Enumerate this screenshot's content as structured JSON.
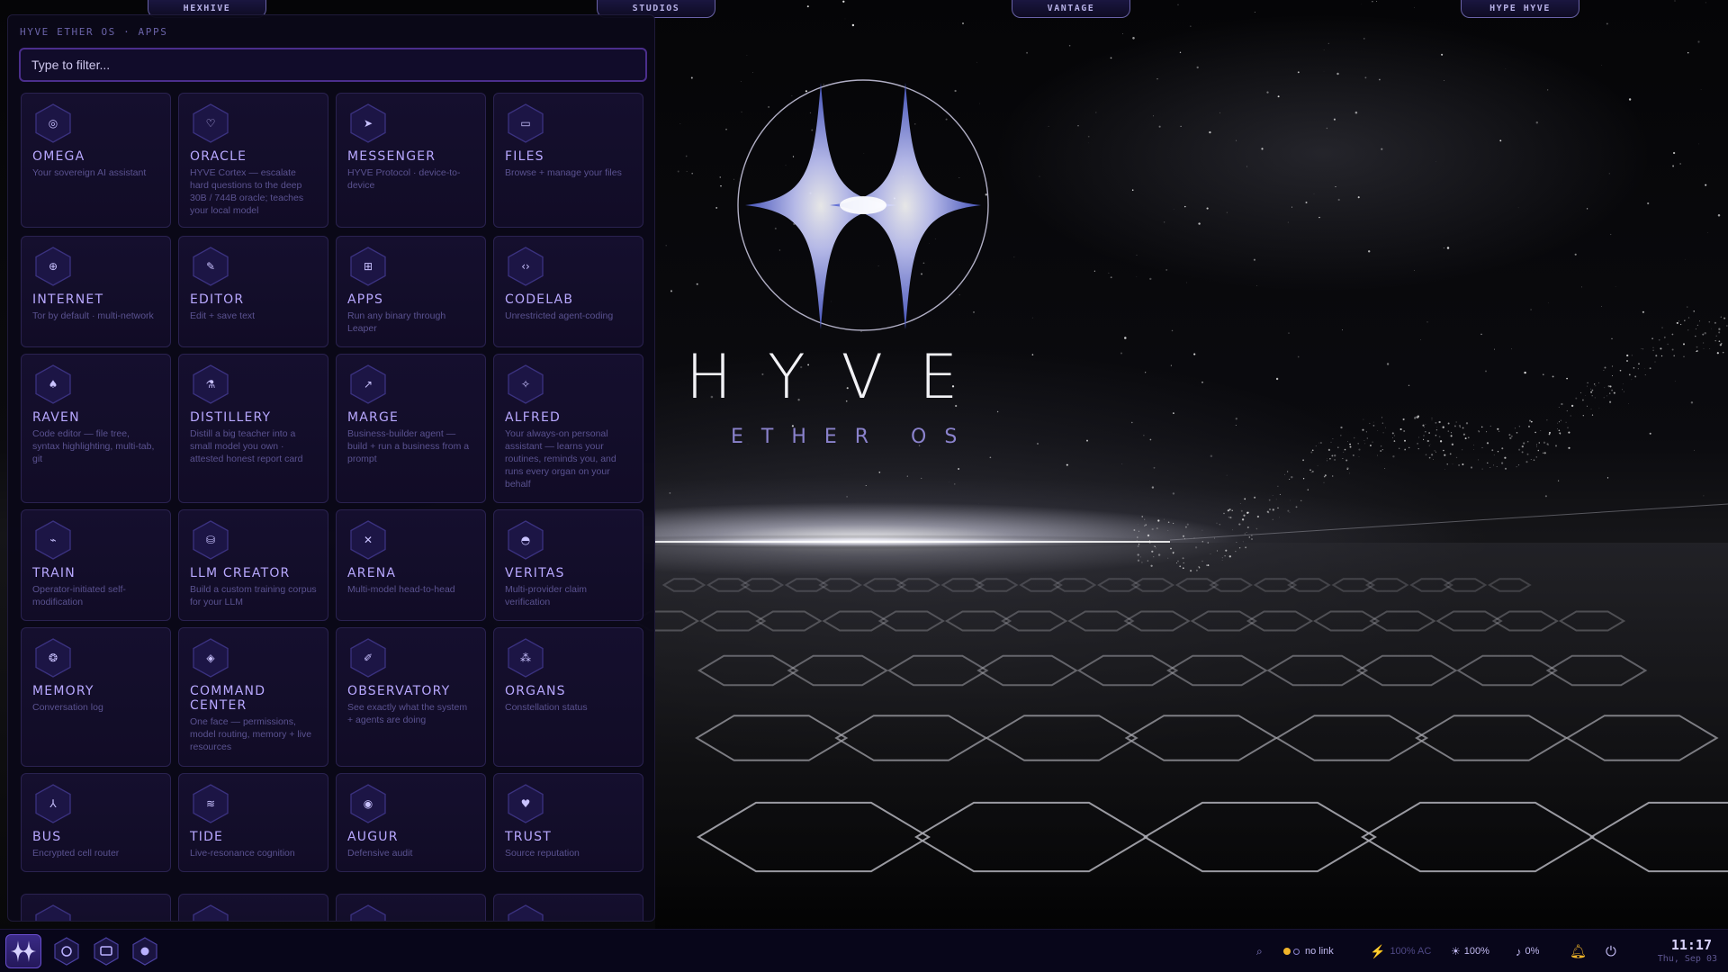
{
  "top_tabs": [
    "HEXHIVE",
    "STUDIOS",
    "VANTAGE",
    "HYPE HYVE"
  ],
  "panel": {
    "title": "HYVE ETHER OS · APPS",
    "filter_placeholder": "Type to filter..."
  },
  "apps": [
    {
      "name": "OMEGA",
      "desc": "Your sovereign AI assistant",
      "icon": "omega-icon",
      "glyph": "◎"
    },
    {
      "name": "ORACLE",
      "desc": "HYVE Cortex — escalate hard questions to the deep 30B / 744B oracle; teaches your local model",
      "icon": "oracle-icon",
      "glyph": "♡"
    },
    {
      "name": "MESSENGER",
      "desc": "HYVE Protocol · device-to-device",
      "icon": "send-icon",
      "glyph": "➤"
    },
    {
      "name": "FILES",
      "desc": "Browse + manage your files",
      "icon": "folder-icon",
      "glyph": "▭"
    },
    {
      "name": "INTERNET",
      "desc": "Tor by default · multi-network",
      "icon": "globe-icon",
      "glyph": "⊕"
    },
    {
      "name": "EDITOR",
      "desc": "Edit + save text",
      "icon": "pencil-icon",
      "glyph": "✎"
    },
    {
      "name": "APPS",
      "desc": "Run any binary through Leaper",
      "icon": "grid-icon",
      "glyph": "⊞"
    },
    {
      "name": "CODELAB",
      "desc": "Unrestricted agent-coding",
      "icon": "code-icon",
      "glyph": "‹›"
    },
    {
      "name": "RAVEN",
      "desc": "Code editor — file tree, syntax highlighting, multi-tab, git",
      "icon": "raven-icon",
      "glyph": "♠"
    },
    {
      "name": "DISTILLERY",
      "desc": "Distill a big teacher into a small model you own · attested honest report card",
      "icon": "flask-icon",
      "glyph": "⚗"
    },
    {
      "name": "MARGE",
      "desc": "Business-builder agent — build + run a business from a prompt",
      "icon": "trend-icon",
      "glyph": "↗"
    },
    {
      "name": "ALFRED",
      "desc": "Your always-on personal assistant — learns your routines, reminds you, and runs every organ on your behalf",
      "icon": "wand-icon",
      "glyph": "✧"
    },
    {
      "name": "TRAIN",
      "desc": "Operator-initiated self-modification",
      "icon": "train-chart-icon",
      "glyph": "⌁"
    },
    {
      "name": "LLM CREATOR",
      "desc": "Build a custom training corpus for your LLM",
      "icon": "database-icon",
      "glyph": "⛁"
    },
    {
      "name": "ARENA",
      "desc": "Multi-model head-to-head",
      "icon": "swords-icon",
      "glyph": "✕"
    },
    {
      "name": "VERITAS",
      "desc": "Multi-provider claim verification",
      "icon": "shield-icon",
      "glyph": "◓"
    },
    {
      "name": "MEMORY",
      "desc": "Conversation log",
      "icon": "memory-icon",
      "glyph": "❂"
    },
    {
      "name": "COMMAND CENTER",
      "desc": "One face — permissions, model routing, memory + live resources",
      "icon": "diamond-icon",
      "glyph": "◈"
    },
    {
      "name": "OBSERVATORY",
      "desc": "See exactly what the system + agents are doing",
      "icon": "telescope-icon",
      "glyph": "✐"
    },
    {
      "name": "ORGANS",
      "desc": "Constellation status",
      "icon": "constellation-icon",
      "glyph": "⁂"
    },
    {
      "name": "BUS",
      "desc": "Encrypted cell router",
      "icon": "router-icon",
      "glyph": "⅄"
    },
    {
      "name": "TIDE",
      "desc": "Live-resonance cognition",
      "icon": "waves-icon",
      "glyph": "≋"
    },
    {
      "name": "AUGUR",
      "desc": "Defensive audit",
      "icon": "eye-icon",
      "glyph": "◉"
    },
    {
      "name": "TRUST",
      "desc": "Source reputation",
      "icon": "heart-shield-icon",
      "glyph": "♥"
    }
  ],
  "logo": {
    "word": "HYVE",
    "sub": "ETHER OS"
  },
  "taskbar": {
    "dock_icons": [
      "omega-icon",
      "files-icon",
      "memory-icon"
    ],
    "network_label": "no link",
    "power_label": "100% AC",
    "brightness_label": "100%",
    "volume_label": "0%",
    "clock_time": "11:17",
    "clock_date": "Thu, Sep 03"
  },
  "colors": {
    "accent": "#8f7bff",
    "panel_bg": "#0a0818",
    "tile_text": "#b8a8ff",
    "status_dot": "#f0b429"
  }
}
